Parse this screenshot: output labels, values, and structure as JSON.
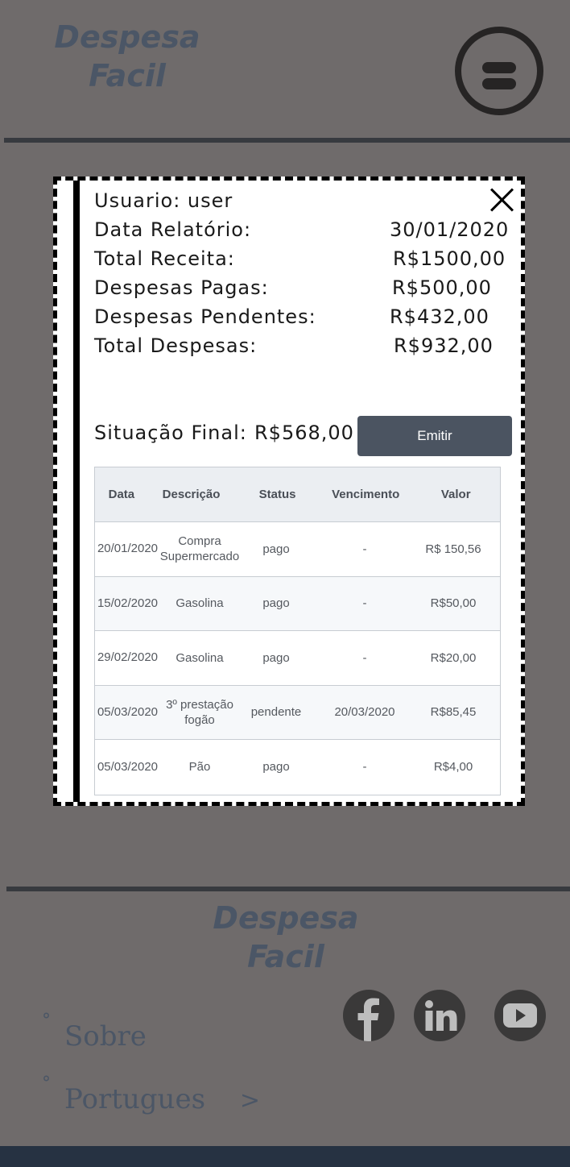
{
  "header": {
    "logo_line1": "Despesa",
    "logo_line2": "Facil"
  },
  "report": {
    "usuario_label": "Usuario: user",
    "data_label": "Data Relatório:",
    "data_value": "30/01/2020",
    "receita_label": "Total Receita:",
    "receita_value": "R$1500,00",
    "pagas_label": "Despesas Pagas:",
    "pagas_value": "R$500,00",
    "pendentes_label": "Despesas Pendentes:",
    "pendentes_value": "R$432,00",
    "total_label": "Total Despesas:",
    "total_value": "R$932,00",
    "situacao_label": "Situação Final:",
    "situacao_value": "R$568,00",
    "emitir_label": "Emitir"
  },
  "table": {
    "headers": [
      "Data",
      "Descrição",
      "Status",
      "Vencimento",
      "Valor"
    ],
    "rows": [
      {
        "data": "20/01/2020",
        "descricao": "Compra Supermercado",
        "status": "pago",
        "vencimento": "-",
        "valor": "R$ 150,56"
      },
      {
        "data": "15/02/2020",
        "descricao": "Gasolina",
        "status": "pago",
        "vencimento": "-",
        "valor": "R$50,00"
      },
      {
        "data": "29/02/2020",
        "descricao": "Gasolina",
        "status": "pago",
        "vencimento": "-",
        "valor": "R$20,00"
      },
      {
        "data": "05/03/2020",
        "descricao": "3º prestação fogão",
        "status": "pendente",
        "vencimento": "20/03/2020",
        "valor": "R$85,45"
      },
      {
        "data": "05/03/2020",
        "descricao": "Pão",
        "status": "pago",
        "vencimento": "-",
        "valor": "R$4,00"
      }
    ]
  },
  "footer": {
    "logo_line1": "Despesa",
    "logo_line2": "Facil",
    "dot": "°",
    "sobre_label": "Sobre",
    "lang_label": "Portugues",
    "lang_arrow": ">"
  },
  "icons": {
    "menu": "menu-icon",
    "close": "close-icon",
    "facebook": "facebook-icon",
    "linkedin": "linkedin-icon",
    "youtube": "youtube-icon"
  },
  "colors": {
    "background": "#6f6b6b",
    "brand_text": "#4b5666",
    "button": "#4b5461",
    "bottom_bar": "#263242"
  }
}
